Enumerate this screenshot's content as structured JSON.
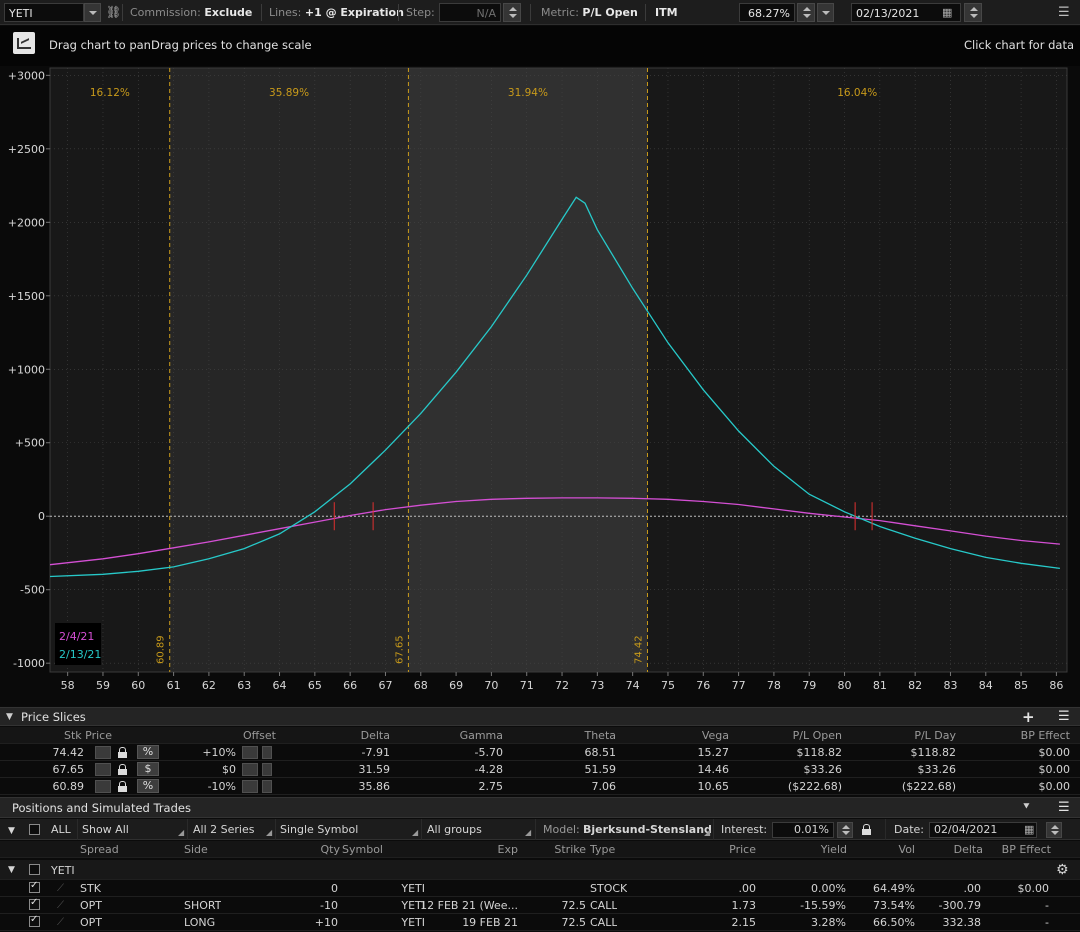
{
  "toolbar": {
    "symbol": "YETI",
    "commission_label": "Commission:",
    "commission_value": "Exclude",
    "lines_label": "Lines:",
    "lines_value": "+1 @ Expiration",
    "step_label": "Step:",
    "step_value": "N/A",
    "metric_label": "Metric:",
    "metric_value": "P/L Open",
    "itm_label": "ITM",
    "itm_value": "68.27%",
    "date_value": "02/13/2021"
  },
  "hint": {
    "left": "Drag chart to panDrag prices to change scale",
    "right": "Click chart for data"
  },
  "chart_data": {
    "type": "line",
    "title": "",
    "xlim": [
      57.5,
      86.3
    ],
    "ylim": [
      -1060,
      3050
    ],
    "x_ticks": [
      58,
      59,
      60,
      61,
      62,
      63,
      64,
      65,
      66,
      67,
      68,
      69,
      70,
      71,
      72,
      73,
      74,
      75,
      76,
      77,
      78,
      79,
      80,
      81,
      82,
      83,
      84,
      85,
      86
    ],
    "y_ticks": [
      {
        "value": 3000,
        "label": "+3000"
      },
      {
        "value": 2500,
        "label": "+2500"
      },
      {
        "value": 2000,
        "label": "+2000"
      },
      {
        "value": 1500,
        "label": "+1500"
      },
      {
        "value": 1000,
        "label": "+1000"
      },
      {
        "value": 500,
        "label": "+500"
      },
      {
        "value": 0,
        "label": "0"
      },
      {
        "value": -500,
        "label": "-500"
      },
      {
        "value": -1000,
        "label": "-1000"
      }
    ],
    "zones": [
      {
        "from": 57.5,
        "to": 60.89,
        "pct": "16.12%",
        "color": "#181818"
      },
      {
        "from": 60.89,
        "to": 67.65,
        "pct": "35.89%",
        "color": "#262626"
      },
      {
        "from": 67.65,
        "to": 74.42,
        "pct": "31.94%",
        "color": "#303030"
      },
      {
        "from": 74.42,
        "to": 86.3,
        "pct": "16.04%",
        "color": "#181818"
      }
    ],
    "price_lines": [
      {
        "x": 60.89,
        "label": "60.89"
      },
      {
        "x": 67.65,
        "label": "67.65"
      },
      {
        "x": 74.42,
        "label": "74.42"
      }
    ],
    "breakeven_marks": [
      65.55,
      66.65,
      80.3,
      80.78
    ],
    "series": [
      {
        "name": "2/4/21",
        "color": "#d44fd4",
        "x": [
          57.5,
          59,
          60,
          61,
          62,
          63,
          64,
          65,
          66,
          67,
          68,
          69,
          70,
          71,
          72,
          73,
          74,
          75,
          76,
          77,
          78,
          79,
          80,
          81,
          82,
          83,
          84,
          85,
          86.1
        ],
        "y": [
          -330,
          -290,
          -255,
          -215,
          -175,
          -130,
          -85,
          -40,
          5,
          45,
          75,
          100,
          115,
          122,
          125,
          125,
          122,
          115,
          100,
          80,
          50,
          20,
          -5,
          -30,
          -65,
          -100,
          -135,
          -165,
          -190
        ]
      },
      {
        "name": "2/13/21",
        "color": "#27c9c9",
        "x": [
          57.5,
          59,
          60,
          61,
          62,
          63,
          64,
          65,
          66,
          67,
          68,
          69,
          70,
          71,
          72,
          72.4,
          72.65,
          73,
          74,
          75,
          76,
          77,
          78,
          79,
          80,
          81,
          82,
          83,
          84,
          85,
          86.1
        ],
        "y": [
          -410,
          -395,
          -375,
          -345,
          -290,
          -220,
          -120,
          30,
          220,
          450,
          700,
          980,
          1290,
          1640,
          2020,
          2170,
          2130,
          1950,
          1550,
          1180,
          860,
          580,
          340,
          150,
          30,
          -70,
          -150,
          -220,
          -280,
          -320,
          -355
        ]
      }
    ]
  },
  "price_slices": {
    "title": "Price Slices",
    "headers": [
      "Stk Price",
      "Offset",
      "Delta",
      "Gamma",
      "Theta",
      "Vega",
      "P/L Open",
      "P/L Day",
      "BP Effect"
    ],
    "rows": [
      {
        "price": "74.42",
        "type": "%",
        "offset": "+10%",
        "delta": "-7.91",
        "gamma": "-5.70",
        "theta": "68.51",
        "vega": "15.27",
        "pl_open": "$118.82",
        "pl_day": "$118.82",
        "bp": "$0.00"
      },
      {
        "price": "67.65",
        "type": "$",
        "offset": "$0",
        "delta": "31.59",
        "gamma": "-4.28",
        "theta": "51.59",
        "vega": "14.46",
        "pl_open": "$33.26",
        "pl_day": "$33.26",
        "bp": "$0.00"
      },
      {
        "price": "60.89",
        "type": "%",
        "offset": "-10%",
        "delta": "35.86",
        "gamma": "2.75",
        "theta": "7.06",
        "vega": "10.65",
        "pl_open": "($222.68)",
        "pl_day": "($222.68)",
        "bp": "$0.00"
      }
    ]
  },
  "positions": {
    "title": "Positions and Simulated Trades",
    "filters": {
      "all": "ALL",
      "show": "Show All",
      "series": "All 2 Series",
      "symbol_mode": "Single Symbol",
      "groups": "All groups",
      "model_label": "Model:",
      "model_value": "Bjerksund-Stensland",
      "interest_label": "Interest:",
      "interest_value": "0.01%",
      "date_label": "Date:",
      "date_value": "02/04/2021"
    },
    "headers": [
      "Spread",
      "Side",
      "Qty",
      "Symbol",
      "Exp",
      "Strike",
      "Type",
      "Price",
      "Yield",
      "Vol",
      "Delta",
      "BP Effect"
    ],
    "group": "YETI",
    "rows": [
      {
        "spread": "STK",
        "side": "",
        "qty": "0",
        "symbol": "YETI",
        "exp": "",
        "strike": "",
        "type": "STOCK",
        "price": ".00",
        "yield": "0.00%",
        "vol": "64.49%",
        "delta": ".00",
        "bp": "$0.00"
      },
      {
        "spread": "OPT",
        "side": "SHORT",
        "qty": "-10",
        "symbol": "YETI",
        "exp": "12 FEB 21 (Wee...",
        "strike": "72.5",
        "type": "CALL",
        "price": "1.73",
        "yield": "-15.59%",
        "vol": "73.54%",
        "delta": "-300.79",
        "bp": "-"
      },
      {
        "spread": "OPT",
        "side": "LONG",
        "qty": "+10",
        "symbol": "YETI",
        "exp": "19 FEB 21",
        "strike": "72.5",
        "type": "CALL",
        "price": "2.15",
        "yield": "3.28%",
        "vol": "66.50%",
        "delta": "332.38",
        "bp": "-"
      }
    ]
  }
}
